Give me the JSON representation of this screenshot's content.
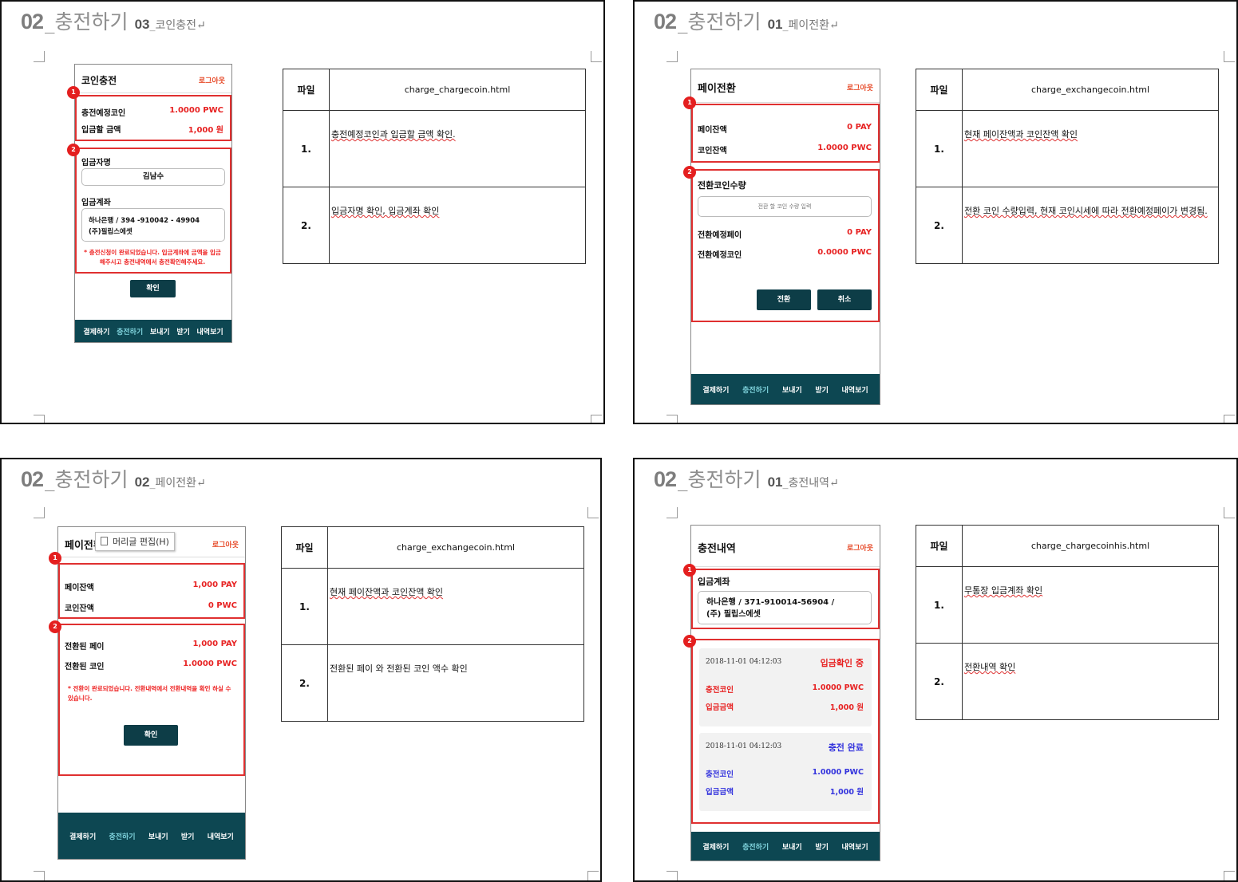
{
  "panels": [
    {
      "heading": {
        "num": "02",
        "name": "_충전하기",
        "snum": "03",
        "sname": "_코인충전",
        "mark": "↵"
      },
      "phone": {
        "title": "코인충전",
        "logout": "로그아웃",
        "badges": [
          "1",
          "2"
        ],
        "box1": [
          {
            "label": "충전예정코인",
            "value": "1.0000 PWC"
          },
          {
            "label": "입금할 금액",
            "value": "1,000 원"
          }
        ],
        "depositor_label": "입금자명",
        "depositor_value": "김남수",
        "account_label": "입금계좌",
        "account_line1": "하나은행 / 394 -910042 - 49904",
        "account_line2": "(주)필립스에셋",
        "note": "* 충전신청이 완료되었습니다. 입금계좌에 금액을 입금해주시고 충전내역에서 충전확인해주세요.",
        "confirm": "확인"
      },
      "table": {
        "key": "파일",
        "file": "charge_chargecoin.html",
        "rows": [
          {
            "no": "1.",
            "desc": "충전예정코인과 입금할 금액 확인."
          },
          {
            "no": "2.",
            "desc": "입금자명 확인, 입금계좌 확인"
          }
        ]
      }
    },
    {
      "heading": {
        "num": "02",
        "name": "_충전하기",
        "snum": "01",
        "sname": "_페이전환",
        "mark": "↵"
      },
      "phone": {
        "title": "페이전환",
        "logout": "로그아웃",
        "badges": [
          "1",
          "2"
        ],
        "box1": [
          {
            "label": "페이잔액",
            "value": "0 PAY"
          },
          {
            "label": "코인잔액",
            "value": "1.0000 PWC"
          }
        ],
        "qty_label": "전환코인수량",
        "qty_placeholder": "전환 할 코인 수량 입력",
        "box2": [
          {
            "label": "전환예정페이",
            "value": "0 PAY"
          },
          {
            "label": "전환예정코인",
            "value": "0.0000 PWC"
          }
        ],
        "convert": "전환",
        "cancel": "취소"
      },
      "table": {
        "key": "파일",
        "file": "charge_exchangecoin.html",
        "rows": [
          {
            "no": "1.",
            "desc": "현재 페이잔액과 코인잔액 확인"
          },
          {
            "no": "2.",
            "desc": "전환 코인 수량입력, 현재 코인시세에 따라 전환예정페이가 변경됨."
          }
        ]
      }
    },
    {
      "heading": {
        "num": "02",
        "name": "_충전하기",
        "snum": "02",
        "sname": "_페이전환",
        "mark": "↵"
      },
      "phone": {
        "title": "페이전환",
        "logout": "로그아웃",
        "tooltip": "머리글 편집(H)",
        "badges": [
          "1",
          "2"
        ],
        "box1": [
          {
            "label": "페이잔액",
            "value": "1,000 PAY"
          },
          {
            "label": "코인잔액",
            "value": "0 PWC"
          }
        ],
        "box2": [
          {
            "label": "전환된 페이",
            "value": "1,000 PAY"
          },
          {
            "label": "전환된 코인",
            "value": "1.0000 PWC"
          }
        ],
        "note": "* 전환이 완료되었습니다. 전환내역에서 전환내역을 확인 하실 수 있습니다.",
        "confirm": "확인"
      },
      "table": {
        "key": "파일",
        "file": "charge_exchangecoin.html",
        "rows": [
          {
            "no": "1.",
            "desc": "현재 페이잔액과 코인잔액 확인"
          },
          {
            "no": "2.",
            "desc": "전환된 페이 와 전환된 코인 액수 확인"
          }
        ]
      }
    },
    {
      "heading": {
        "num": "02",
        "name": "_충전하기",
        "snum": "01",
        "sname": "_충전내역",
        "mark": "↵"
      },
      "phone": {
        "title": "충전내역",
        "logout": "로그아웃",
        "badges": [
          "1",
          "2"
        ],
        "account_label": "입금계좌",
        "account_line1": "하나은행 / 371-910014-56904 /",
        "account_line2": "(주) 필립스에셋",
        "cards": [
          {
            "ts": "2018-11-01 04:12:03",
            "status": "입금확인 중",
            "coin_label": "충전코인",
            "coin": "1.0000 PWC",
            "amt_label": "입금금액",
            "amt": "1,000 원",
            "color": "#e72222"
          },
          {
            "ts": "2018-11-01 04:12:03",
            "status": "충전 완료",
            "coin_label": "충전코인",
            "coin": "1.0000 PWC",
            "amt_label": "입금금액",
            "amt": "1,000 원",
            "color": "#3333dd"
          }
        ]
      },
      "table": {
        "key": "파일",
        "file": "charge_chargecoinhis.html",
        "rows": [
          {
            "no": "1.",
            "desc": "무통장 입금계좌 확인"
          },
          {
            "no": "2.",
            "desc": "전환내역 확인"
          }
        ]
      }
    }
  ],
  "nav": [
    "결제하기",
    "충전하기",
    "보내기",
    "받기",
    "내역보기"
  ],
  "nav_active_index": 1,
  "colors": {
    "accent_red": "#e03030",
    "nav_bg": "#0d4752",
    "button_bg": "#0d3d47",
    "nav_active": "#7fd3dc",
    "complete_blue": "#3333dd"
  }
}
